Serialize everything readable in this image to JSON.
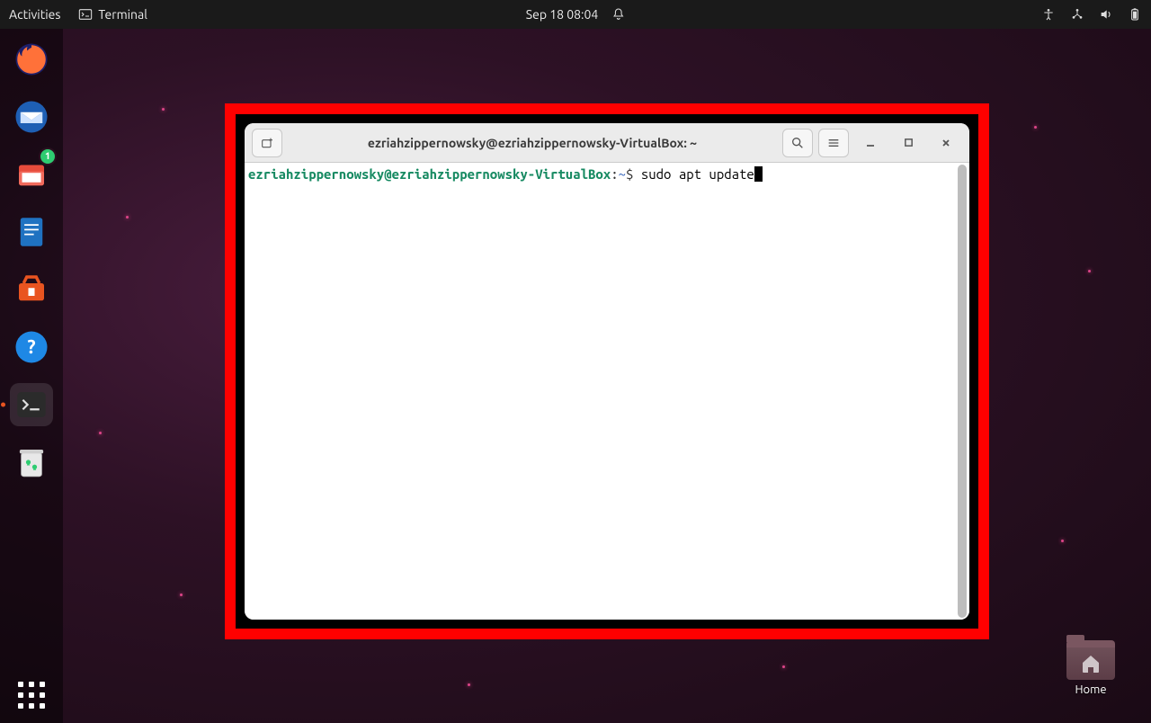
{
  "topbar": {
    "activities": "Activities",
    "app_label": "Terminal",
    "datetime": "Sep 18  08:04"
  },
  "dock": {
    "files_badge": "1"
  },
  "terminal": {
    "window_title": "ezriahzippernowsky@ezriahzippernowsky-VirtualBox: ~",
    "prompt_user_host": "ezriahzippernowsky@ezriahzippernowsky-VirtualBox",
    "prompt_sep": ":",
    "prompt_path": "~",
    "prompt_symbol": "$ ",
    "command": "sudo apt update"
  },
  "desktop": {
    "home_label": "Home"
  }
}
